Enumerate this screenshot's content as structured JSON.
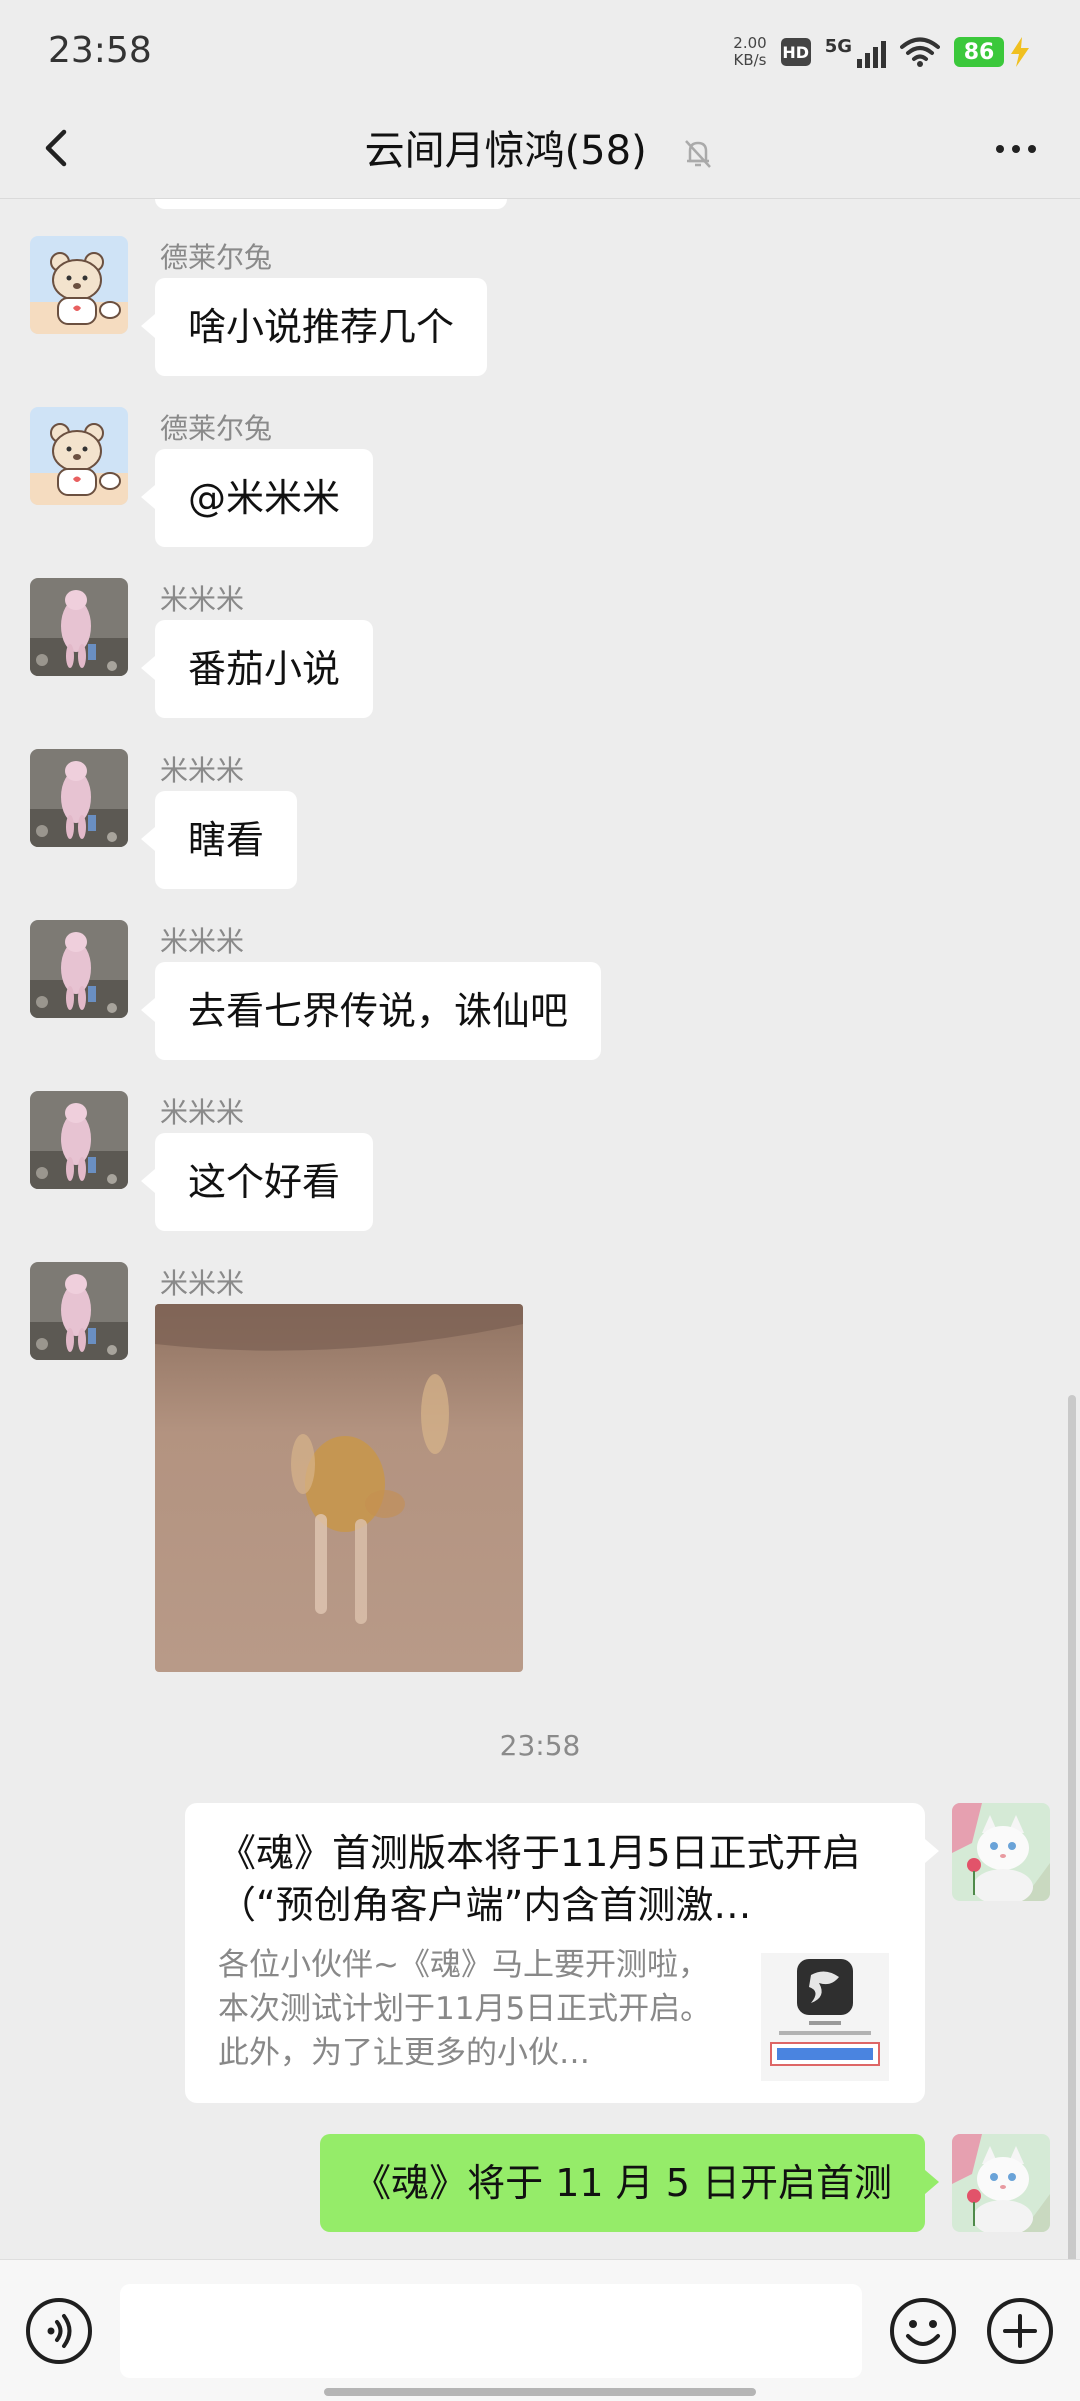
{
  "status": {
    "time": "23:58",
    "net_speed_value": "2.00",
    "net_speed_unit": "KB/s",
    "hd_badge": "HD",
    "network": "5G",
    "battery": "86",
    "icons": [
      "hd-icon",
      "signal-icon",
      "wifi-icon",
      "battery-icon",
      "charging-icon"
    ]
  },
  "header": {
    "title": "云间月惊鸿(58)",
    "icons": [
      "back-icon",
      "mute-bell-icon",
      "more-icon"
    ]
  },
  "messages": [
    {
      "sender": "德莱尔兔",
      "text": "啥小说推荐几个",
      "avatar": "bear-avatar"
    },
    {
      "sender": "德莱尔兔",
      "text": "@米米米",
      "avatar": "bear-avatar"
    },
    {
      "sender": "米米米",
      "text": "番茄小说",
      "avatar": "pig-avatar"
    },
    {
      "sender": "米米米",
      "text": "瞎看",
      "avatar": "pig-avatar"
    },
    {
      "sender": "米米米",
      "text": "去看七界传说，诛仙吧",
      "avatar": "pig-avatar"
    },
    {
      "sender": "米米米",
      "text": "这个好看",
      "avatar": "pig-avatar"
    },
    {
      "sender": "米米米",
      "image": "running-dog-photo",
      "avatar": "pig-avatar"
    }
  ],
  "timestamp": "23:58",
  "link_card": {
    "title": "《魂》首测版本将于11月5日正式开启（“预创角客户端”内含首测激…",
    "desc": "各位小伙伴~《魂》马上要开测啦，本次测试计划于11月5日正式开启。此外，为了让更多的小伙…",
    "thumb": "game-logo-thumbnail",
    "avatar": "cat-avatar"
  },
  "sent_message": {
    "text": "《魂》将于 11 月 5 日开启首测",
    "avatar": "cat-avatar"
  },
  "input_bar": {
    "placeholder": "",
    "icons": [
      "voice-icon",
      "emoji-icon",
      "plus-icon"
    ]
  },
  "colors": {
    "background": "#ededed",
    "sent_bubble": "#95ec69",
    "received_bubble": "#ffffff",
    "battery": "#3bc83b"
  }
}
